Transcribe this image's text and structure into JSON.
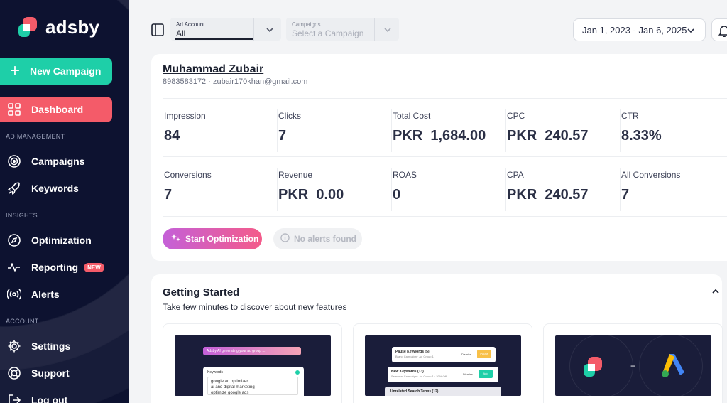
{
  "sidebar": {
    "logo_text": "adsby",
    "new_campaign": "New Campaign",
    "sections": {
      "ad_management": "AD MANAGEMENT",
      "insights": "INSIGHTS",
      "account": "ACCOUNT"
    },
    "items": {
      "dashboard": "Dashboard",
      "campaigns": "Campaigns",
      "keywords": "Keywords",
      "optimization": "Optimization",
      "reporting": "Reporting",
      "reporting_badge": "NEW",
      "alerts": "Alerts",
      "settings": "Settings",
      "support": "Support",
      "logout": "Log out"
    }
  },
  "topbar": {
    "ad_account_label": "Ad Account",
    "ad_account_value": "All",
    "campaigns_label": "Campaigns",
    "campaigns_placeholder": "Select a Campaign",
    "date_range": "Jan 1, 2023 - Jan 6, 2025"
  },
  "account": {
    "name": "Muhammad Zubair",
    "contact": "8983583172 · zubair170khan@gmail.com"
  },
  "metrics": [
    {
      "label": "Impression",
      "value": "84"
    },
    {
      "label": "Clicks",
      "value": "7"
    },
    {
      "label": "Total Cost",
      "value": "PKR  1,684.00"
    },
    {
      "label": "CPC",
      "value": "PKR  240.57"
    },
    {
      "label": "CTR",
      "value": "8.33%"
    },
    {
      "label": "Conversions",
      "value": "7"
    },
    {
      "label": "Revenue",
      "value": "PKR  0.00"
    },
    {
      "label": "ROAS",
      "value": "0"
    },
    {
      "label": "CPA",
      "value": "PKR  240.57"
    },
    {
      "label": "All Conversions",
      "value": "7"
    }
  ],
  "actions": {
    "start_optimization": "Start Optimization",
    "no_alerts": "No alerts found"
  },
  "getting_started": {
    "title": "Getting Started",
    "subtitle": "Take few minutes to discover about new features",
    "card1": {
      "banner": "Adsby AI generating your ad group ...",
      "keywords_label": "Keywords",
      "kw1": "google ad optimizer",
      "kw2": "ai and digital marketing",
      "kw3": "optimize google ads"
    },
    "card2": {
      "row1_title": "Pause Keywords (5)",
      "row1_sub": "Brand Campaign · Ad Group 1",
      "row1_dismiss": "Dismiss",
      "row1_action": "Pause",
      "row2_title": "New Keywords (13)",
      "row2_sub": "Seasonal Campaign · Ad Group 1 · 20% Off",
      "row2_dismiss": "Dismiss",
      "row2_action": "Add",
      "row3_title": "Unrelated Search Terms (12)"
    },
    "card3": {
      "plus": "+"
    }
  },
  "colors": {
    "sidebar_bg": "#0d1230",
    "accent_green": "#1ecfa8",
    "accent_red": "#f45b69"
  }
}
